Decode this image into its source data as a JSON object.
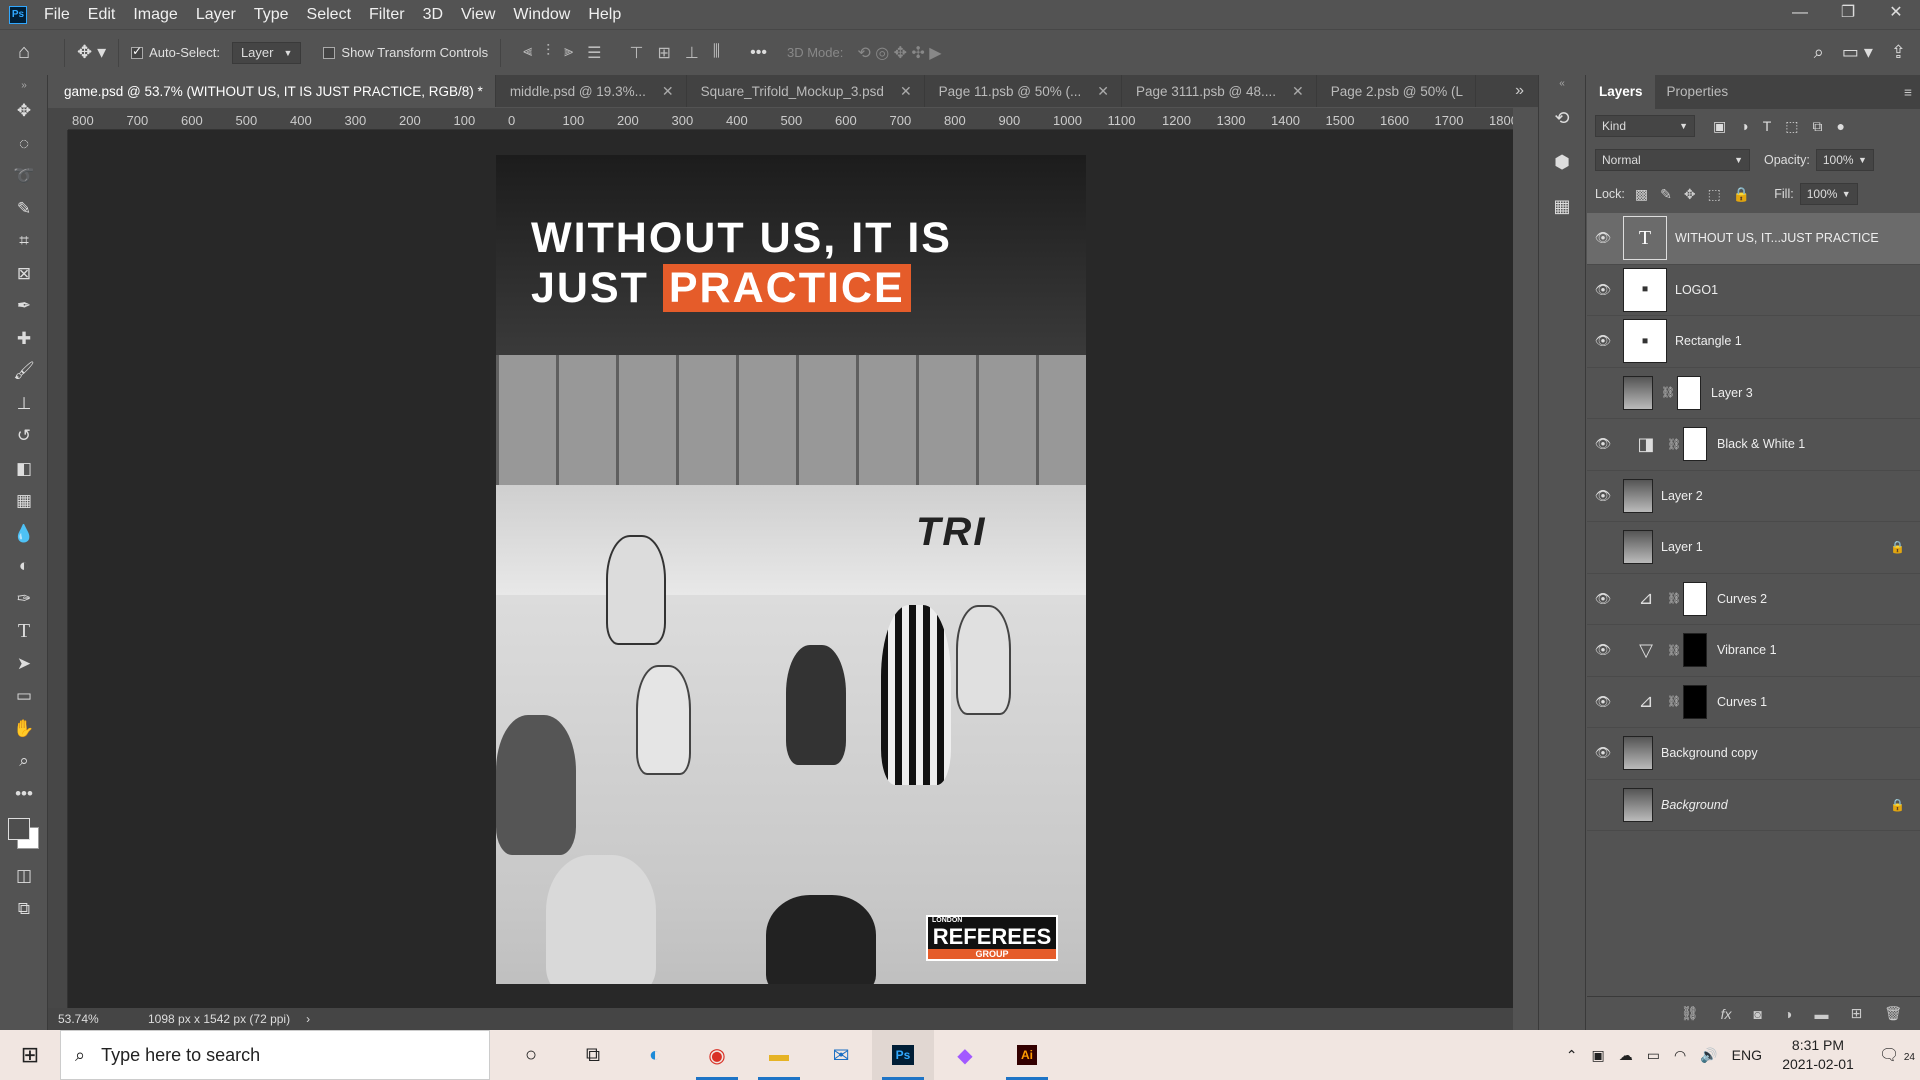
{
  "menubar": {
    "app_icon": "Ps",
    "items": [
      "File",
      "Edit",
      "Image",
      "Layer",
      "Type",
      "Select",
      "Filter",
      "3D",
      "View",
      "Window",
      "Help"
    ],
    "window_controls": [
      "—",
      "❐",
      "✕"
    ]
  },
  "options_bar": {
    "auto_select_label": "Auto-Select:",
    "auto_select_checked": true,
    "auto_select_target": "Layer",
    "transform_controls_label": "Show Transform Controls",
    "transform_controls_checked": false,
    "more": "•••",
    "mode3d_label": "3D Mode:"
  },
  "tools": [
    "move-tool",
    "marquee-tool",
    "lasso-tool",
    "quick-select-tool",
    "crop-tool",
    "frame-tool",
    "eyedropper-tool",
    "healing-tool",
    "brush-tool",
    "stamp-tool",
    "history-brush-tool",
    "eraser-tool",
    "gradient-tool",
    "blur-tool",
    "dodge-tool",
    "pen-tool",
    "type-tool",
    "path-select-tool",
    "rectangle-tool",
    "hand-tool",
    "zoom-tool",
    "more-tools"
  ],
  "colors": {
    "foreground": "#4e4e4e",
    "background": "#ffffff"
  },
  "tabs": [
    {
      "label": "game.psd @ 53.7% (WITHOUT US, IT IS JUST PRACTICE, RGB/8) *",
      "active": true
    },
    {
      "label": "middle.psd @ 19.3%...",
      "active": false
    },
    {
      "label": "Square_Trifold_Mockup_3.psd",
      "active": false
    },
    {
      "label": "Page 11.psb @ 50% (...",
      "active": false
    },
    {
      "label": "Page 3111.psb @ 48....",
      "active": false
    },
    {
      "label": "Page 2.psb @ 50% (L",
      "active": false
    }
  ],
  "ruler_h": [
    "800",
    "700",
    "600",
    "500",
    "400",
    "300",
    "200",
    "100",
    "0",
    "100",
    "200",
    "300",
    "400",
    "500",
    "600",
    "700",
    "800",
    "900",
    "1000",
    "1100",
    "1200",
    "1300",
    "1400",
    "1500",
    "1600",
    "1700",
    "1800"
  ],
  "artboard": {
    "headline_line1": "WITHOUT US, IT IS",
    "headline_line2_prefix": "JUST ",
    "headline_highlight": "PRACTICE",
    "highlight_color": "#e55c2a",
    "board_text": "TRI",
    "logo_small": "LONDON",
    "logo_main": "REFEREES",
    "logo_sub": "GROUP"
  },
  "status": {
    "zoom": "53.74%",
    "dims": "1098 px x 1542 px (72 ppi)"
  },
  "panel": {
    "tabs": [
      "Layers",
      "Properties"
    ],
    "filter_kind": "Kind",
    "blend_mode": "Normal",
    "opacity_label": "Opacity:",
    "opacity": "100%",
    "lock_label": "Lock:",
    "fill_label": "Fill:",
    "fill": "100%",
    "layers": [
      {
        "name": "WITHOUT US, IT...JUST PRACTICE",
        "visible": true,
        "selected": true,
        "kind": "text"
      },
      {
        "name": "LOGO1",
        "visible": true,
        "kind": "smart"
      },
      {
        "name": "Rectangle 1",
        "visible": true,
        "kind": "smart"
      },
      {
        "name": "Layer 3",
        "visible": false,
        "kind": "photo-mask"
      },
      {
        "name": "Black & White 1",
        "visible": true,
        "kind": "adj-bw"
      },
      {
        "name": "Layer 2",
        "visible": true,
        "kind": "photo"
      },
      {
        "name": "Layer 1",
        "visible": false,
        "kind": "photo",
        "locked": true
      },
      {
        "name": "Curves 2",
        "visible": true,
        "kind": "adj-curves"
      },
      {
        "name": "Vibrance 1",
        "visible": true,
        "kind": "adj-vibrance"
      },
      {
        "name": "Curves 1",
        "visible": true,
        "kind": "adj-curves"
      },
      {
        "name": "Background copy",
        "visible": true,
        "kind": "photo"
      },
      {
        "name": "Background",
        "visible": false,
        "kind": "photo",
        "locked": true,
        "italic": true
      }
    ]
  },
  "taskbar": {
    "search_placeholder": "Type here to search",
    "apps": [
      "cortana",
      "task-view",
      "edge",
      "chrome",
      "file-explorer",
      "mail",
      "photoshop",
      "figma",
      "illustrator"
    ],
    "lang": "ENG",
    "time": "8:31 PM",
    "date": "2021-02-01",
    "notifications": "24"
  }
}
